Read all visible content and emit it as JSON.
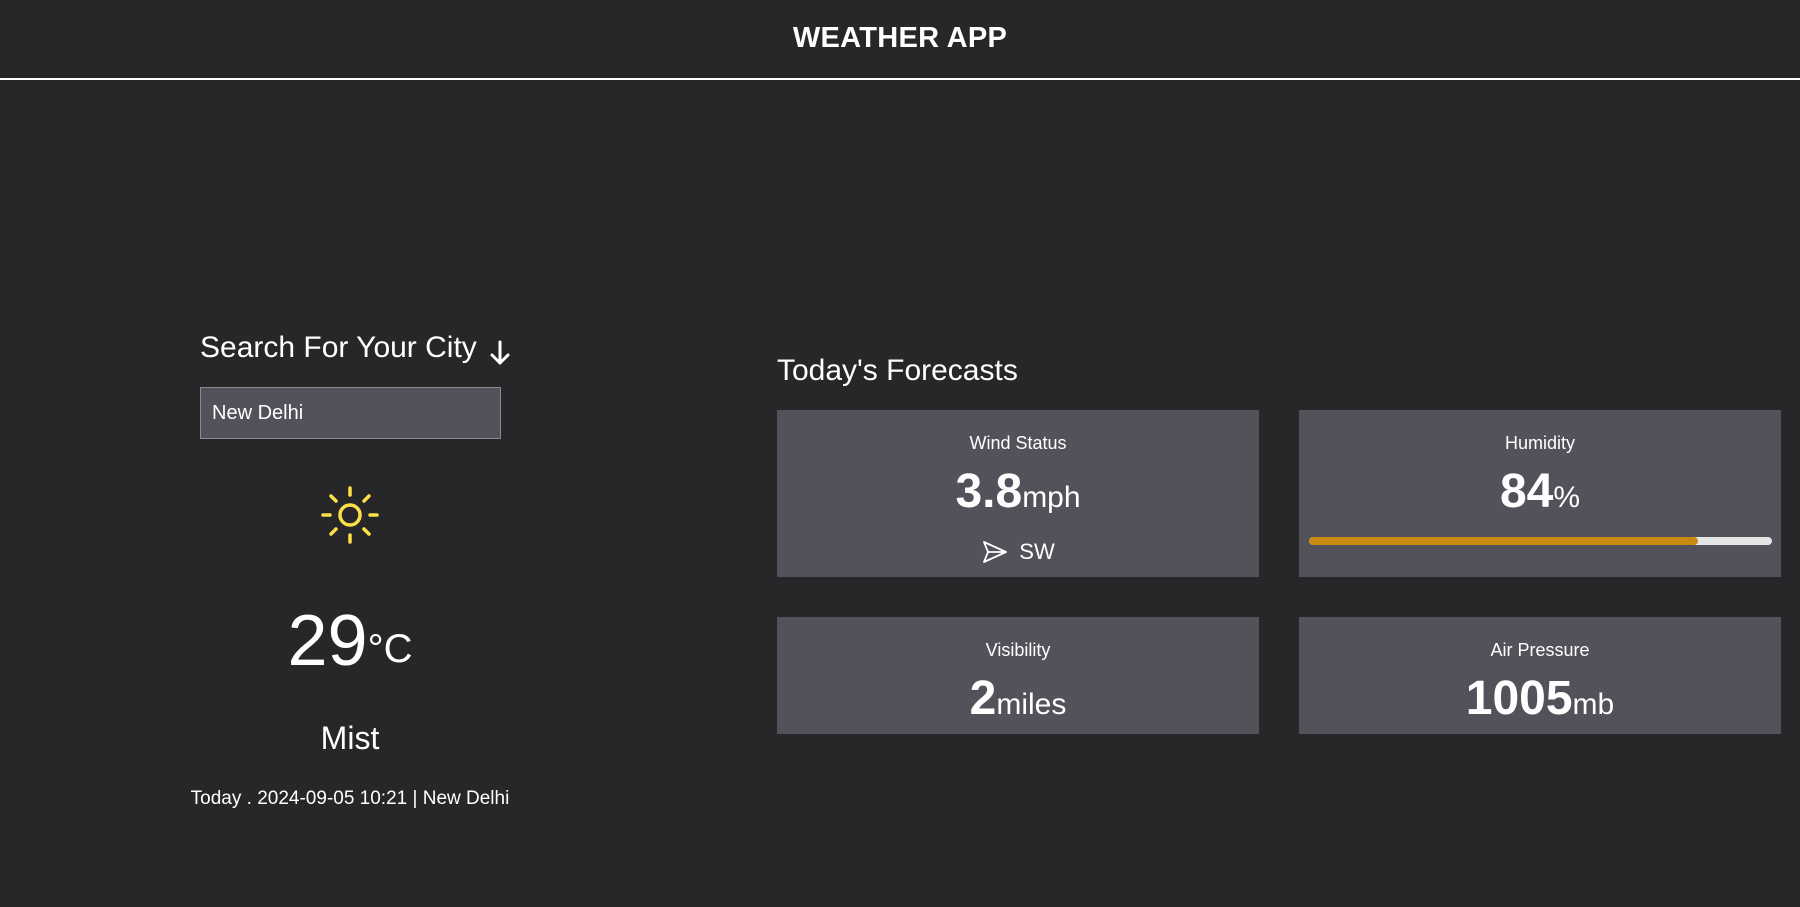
{
  "header": {
    "title": "WEATHER APP"
  },
  "search": {
    "heading": "Search For Your City",
    "value": "New Delhi",
    "placeholder": ""
  },
  "current": {
    "icon": "sun-icon",
    "temperature": "29",
    "unit": "°C",
    "condition": "Mist",
    "date_line": "Today . 2024-09-05 10:21 | New Delhi"
  },
  "forecast": {
    "heading": "Today's Forecasts",
    "wind": {
      "label": "Wind Status",
      "value": "3.8",
      "unit": "mph",
      "direction": "SW",
      "icon": "send-icon"
    },
    "humidity": {
      "label": "Humidity",
      "value": "84",
      "unit": "%",
      "level_percent": 84
    },
    "visibility": {
      "label": "Visibility",
      "value": "2",
      "unit": "miles"
    },
    "pressure": {
      "label": "Air Pressure",
      "value": "1005",
      "unit": "mb"
    }
  },
  "colors": {
    "background": "#27272a",
    "card": "#52525b",
    "accent": "#c98a12",
    "sun": "#fde047"
  }
}
